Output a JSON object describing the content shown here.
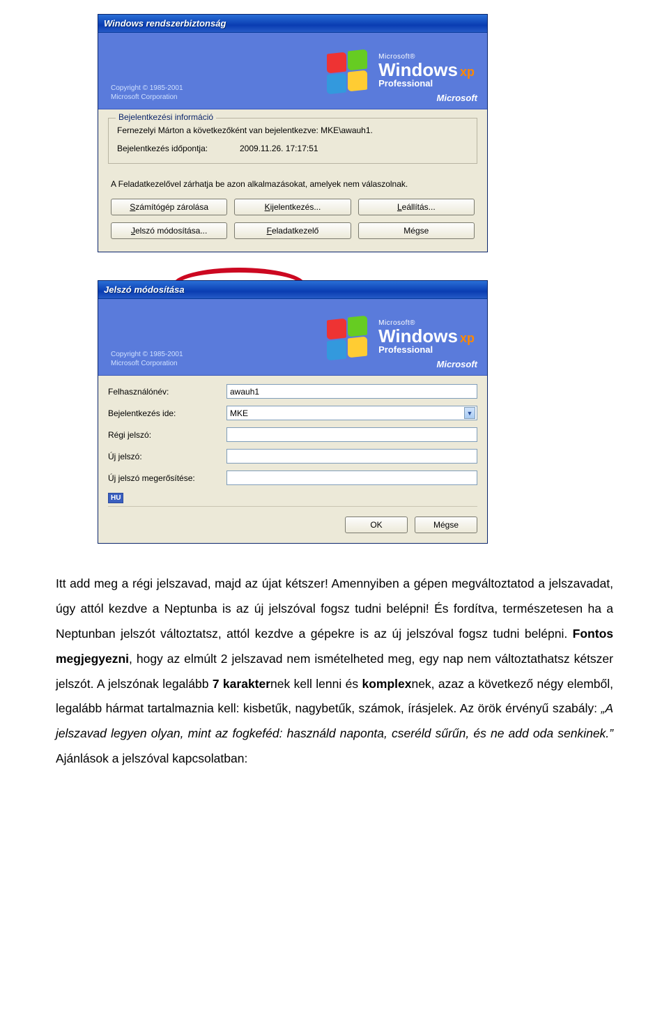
{
  "dialog1": {
    "title": "Windows rendszerbiztonság",
    "brand": {
      "copyright_line1": "Copyright © 1985-2001",
      "copyright_line2": "Microsoft Corporation",
      "ms_line": "Microsoft®",
      "win_line": "Windows",
      "xp_badge": "xp",
      "pro_line": "Professional",
      "ms_corner": "Microsoft"
    },
    "group_legend": "Bejelentkezési információ",
    "logged_in_as": "Fernezelyi Márton a következőként van bejelentkezve: MKE\\awauh1.",
    "login_time_label": "Bejelentkezés időpontja:",
    "login_time_value": "2009.11.26. 17:17:51",
    "explain": "A Feladatkezelővel zárhatja be azon alkalmazásokat, amelyek nem válaszolnak.",
    "buttons": {
      "lock": "Számítógép zárolása",
      "logout": "Kijelentkezés...",
      "shutdown": "Leállítás...",
      "password": "Jelszó módosítása...",
      "taskmgr": "Feladatkezelő",
      "cancel": "Mégse"
    }
  },
  "dialog2": {
    "title": "Jelszó módosítása",
    "brand": {
      "copyright_line1": "Copyright © 1985-2001",
      "copyright_line2": "Microsoft Corporation",
      "ms_line": "Microsoft®",
      "win_line": "Windows",
      "xp_badge": "xp",
      "pro_line": "Professional",
      "ms_corner": "Microsoft"
    },
    "fields": {
      "user_label": "Felhasználónév:",
      "user_value": "awauh1",
      "domain_label": "Bejelentkezés ide:",
      "domain_value": "MKE",
      "oldpw_label": "Régi jelszó:",
      "newpw_label": "Új jelszó:",
      "confirm_label": "Új jelszó megerősítése:"
    },
    "lang_indicator": "HU",
    "buttons": {
      "ok": "OK",
      "cancel": "Mégse"
    }
  },
  "body": {
    "p1a": "Itt add meg a régi jelszavad, majd az újat kétszer! Amennyiben a gépen megváltoztatod a jelszavadat, úgy attól kezdve a Neptunba is az új jelszóval fogsz tudni belépni! És fordítva, természetesen ha a Neptunban jelszót változtatsz, attól kezdve a gépekre is az új jelszóval fogsz tudni belépni. ",
    "bold1": "Fontos megjegyezni",
    "p1b": ", hogy az elmúlt 2 jelszavad nem ismételheted meg, egy nap nem változtathatsz kétszer jelszót. A jelszónak legalább ",
    "bold2": "7 karakter",
    "p1c": "nek kell lenni és ",
    "bold3": "komplex",
    "p1d": "nek, azaz a következő négy elemből, legalább hármat tartalmaznia kell: kisbetűk, nagybetűk, számok, írásjelek. Az örök érvényű szabály: ",
    "quote": "„A jelszavad legyen olyan, mint az fogkeféd: használd naponta, cseréld sűrűn, és ne add oda senkinek.”",
    "p1e": " Ajánlások a jelszóval kapcsolatban:"
  }
}
